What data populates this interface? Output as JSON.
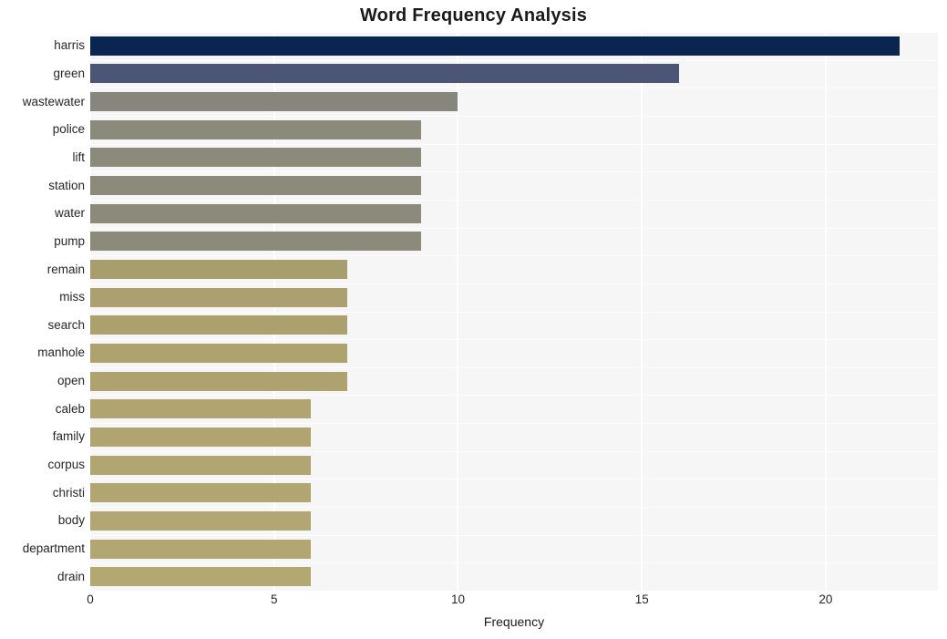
{
  "chart_data": {
    "type": "bar",
    "orientation": "horizontal",
    "title": "Word Frequency Analysis",
    "xlabel": "Frequency",
    "ylabel": "",
    "categories": [
      "harris",
      "green",
      "wastewater",
      "police",
      "lift",
      "station",
      "water",
      "pump",
      "remain",
      "miss",
      "search",
      "manhole",
      "open",
      "caleb",
      "family",
      "corpus",
      "christi",
      "body",
      "department",
      "drain"
    ],
    "values": [
      22,
      16,
      10,
      9,
      9,
      9,
      9,
      9,
      7,
      7,
      7,
      7,
      7,
      6,
      6,
      6,
      6,
      6,
      6,
      6
    ],
    "bar_colors": [
      "#0a2550",
      "#4b5575",
      "#87867c",
      "#8c8a7b",
      "#8c8a7b",
      "#8c8a7b",
      "#8c8a7b",
      "#8c8a7b",
      "#a89d6d",
      "#ad a070",
      "#aca06f",
      "#aea26f",
      "#aea26f",
      "#b0a471",
      "#b0a471",
      "#b1a571",
      "#b1a571",
      "#b2a672",
      "#b2a672",
      "#b3a772"
    ],
    "xticks": [
      0,
      5,
      10,
      15,
      20
    ],
    "xtick_labels": [
      "0",
      "5",
      "10",
      "15",
      "20"
    ],
    "xlim": [
      0,
      23.05
    ],
    "grid": true,
    "grid_color": "#ffffff",
    "plot_background": "#f6f6f7",
    "figure_background": "#ffffff"
  }
}
